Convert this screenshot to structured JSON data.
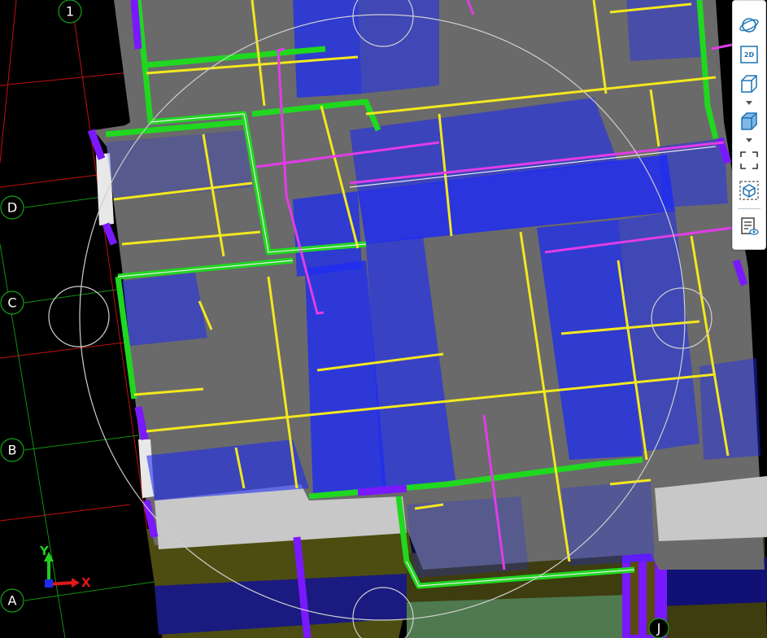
{
  "grid_bubbles": {
    "top": [
      "1"
    ],
    "left": [
      "D",
      "C",
      "B",
      "A"
    ],
    "bottom": [
      "J"
    ]
  },
  "axis_indicator": {
    "x_label": "X",
    "y_label": "Y"
  },
  "toolbar": {
    "buttons": [
      {
        "name": "orbit-button",
        "icon": "orbit-icon"
      },
      {
        "name": "view-2d-button",
        "icon": "2d-icon",
        "label": "2D"
      },
      {
        "name": "view-cube-wireframe-button",
        "icon": "cube-outline-icon"
      },
      {
        "name": "view-cube-shaded-button",
        "icon": "cube-shaded-icon"
      },
      {
        "name": "zoom-extents-button",
        "icon": "fit-frame-icon"
      },
      {
        "name": "section-box-button",
        "icon": "section-box-icon"
      },
      {
        "name": "view-properties-button",
        "icon": "document-view-icon"
      }
    ]
  },
  "colors": {
    "background": "#000000",
    "slab": "#6b6b6b",
    "slab_light": "#c9c9c9",
    "wall_green": "#1fd81f",
    "wall_purple": "#7a18ff",
    "beam_yellow": "#f0e61e",
    "beam_magenta": "#e23ce8",
    "glass_blue": "#1f2cf0",
    "grid_red": "#d01010",
    "grid_green": "#18a018",
    "toolbar_accent": "#1b73b6"
  }
}
